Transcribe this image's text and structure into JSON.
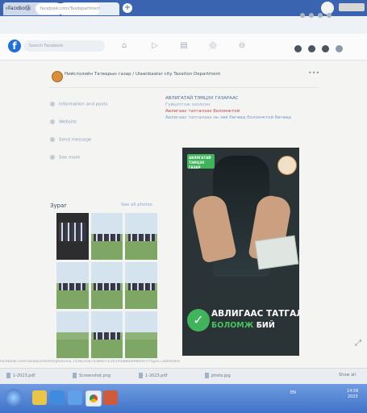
{
  "browser": {
    "tabs": [
      {
        "label": "Facebook"
      },
      {
        "label": "Facebook"
      }
    ],
    "new_tab_symbol": "+",
    "url": "facebook.com/Taxdepartment",
    "nav": {
      "back": "←",
      "forward": "→",
      "reload": "C"
    }
  },
  "facebook": {
    "logo": "f",
    "search_placeholder": "Search Facebook"
  },
  "page": {
    "name": "Нийслэлийн Татварын газар / Ulaanbaatar city Taxation Department",
    "more": "•••",
    "left_links": [
      {
        "label": "Information and posts"
      },
      {
        "label": "Website"
      },
      {
        "label": "Send message"
      },
      {
        "label": "See more"
      }
    ],
    "post_lines": [
      "АВЛИГАТАЙ ТЭМЦЭХ ГАЗАРААС",
      "Гүйцэтгэж эхэлсэн",
      "Авлигаас татгалзах боломжтой",
      "Авлигаас татгалзах нь зөв бөгөөд боломжтой бөгөөд"
    ],
    "photos_title": "Зураг",
    "photos_link": "See all photos",
    "poster": {
      "brand": "АВЛИГАТАЙ ТЭМЦЭХ ГАЗАР",
      "line1": "АВЛИГААС ТАТГАЛЗАХ",
      "line2_green": "БОЛОМЖ",
      "line2_white": "БИЙ"
    }
  },
  "status_url": "facebook.com/Taxdepartment/photos/a.1558235674389071/2019588604986407/?type=3&theater",
  "downloads": [
    {
      "name": "1-2023.pdf"
    },
    {
      "name": "Screenshot.png"
    },
    {
      "name": "1-2023.pdf"
    },
    {
      "name": "photo.jpg"
    }
  ],
  "downloads_show_all": "Show all",
  "taskbar": {
    "tray": "EN",
    "time": "14:56",
    "date": "2023"
  },
  "colors": {
    "tab_strip": "#3a63b0",
    "facebook_blue": "#1f6fe0",
    "poster_green": "#44c45e",
    "taskbar": "#3f73c9"
  }
}
